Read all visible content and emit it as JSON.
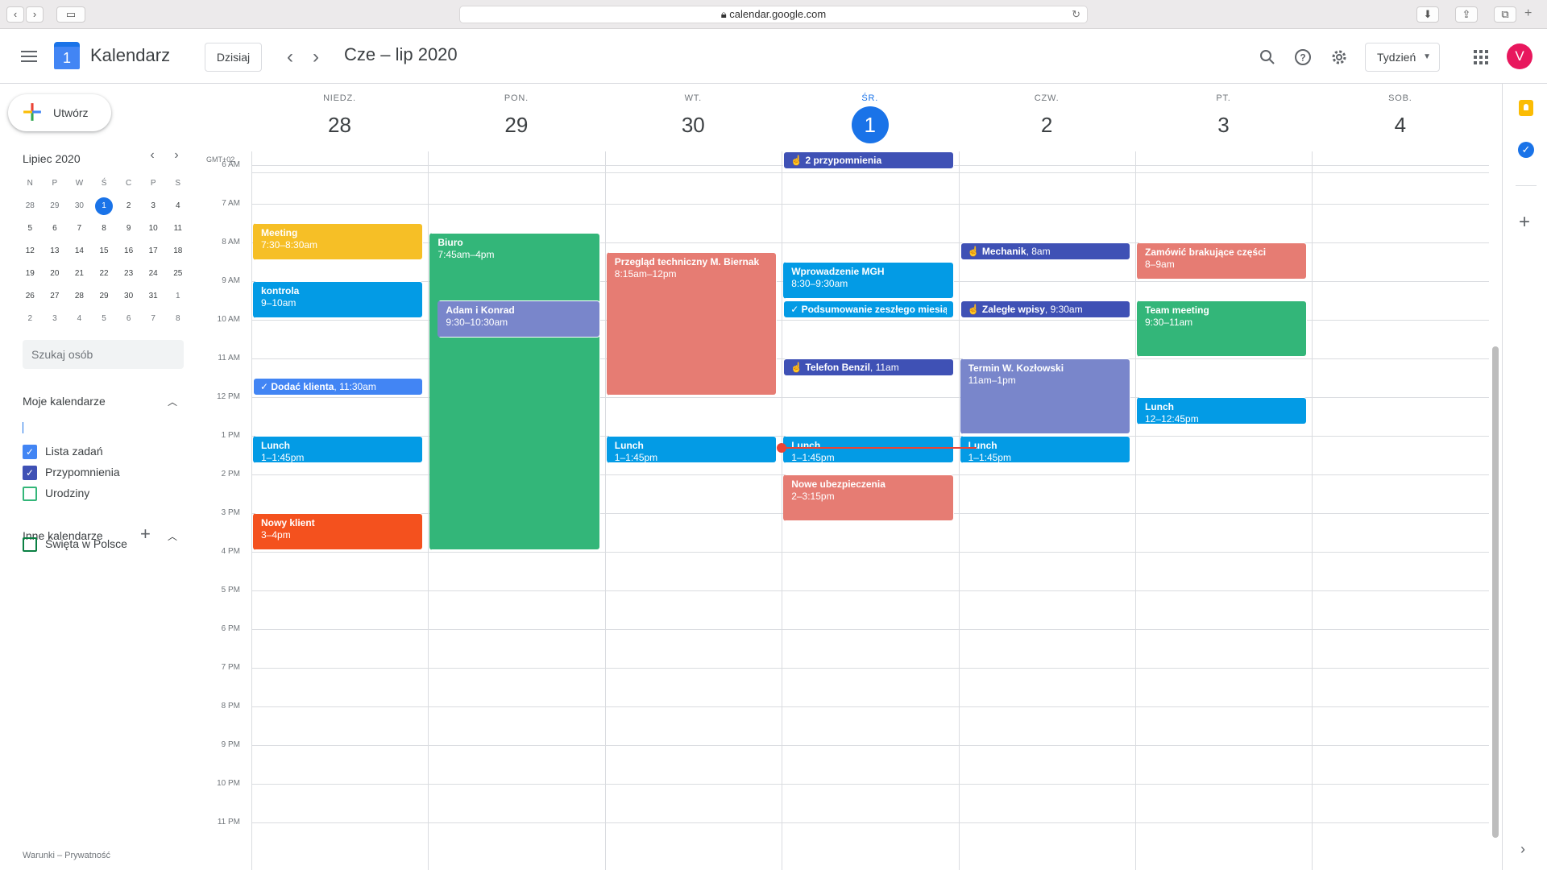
{
  "browser": {
    "url": "calendar.google.com"
  },
  "header": {
    "app_name": "Kalendarz",
    "today_button": "Dzisiaj",
    "period": "Cze – lip 2020",
    "view": "Tydzień",
    "avatar_letter": "V"
  },
  "sidebar": {
    "create_label": "Utwórz",
    "mini_month": "Lipiec 2020",
    "mini_weekdays": [
      "N",
      "P",
      "W",
      "Ś",
      "C",
      "P",
      "S"
    ],
    "mini_weeks": [
      [
        "28",
        "29",
        "30",
        "1",
        "2",
        "3",
        "4"
      ],
      [
        "5",
        "6",
        "7",
        "8",
        "9",
        "10",
        "11"
      ],
      [
        "12",
        "13",
        "14",
        "15",
        "16",
        "17",
        "18"
      ],
      [
        "19",
        "20",
        "21",
        "22",
        "23",
        "24",
        "25"
      ],
      [
        "26",
        "27",
        "28",
        "29",
        "30",
        "31",
        "1"
      ],
      [
        "2",
        "3",
        "4",
        "5",
        "6",
        "7",
        "8"
      ]
    ],
    "search_placeholder": "Szukaj osób",
    "my_calendars_title": "Moje kalendarze",
    "my_calendars": [
      {
        "name": "Lista zadań",
        "checked": true
      },
      {
        "name": "Przypomnienia",
        "checked": true
      },
      {
        "name": "Urodziny",
        "checked": false
      }
    ],
    "other_calendars_title": "Inne kalendarze",
    "other_calendars": [
      {
        "name": "Święta w Polsce",
        "checked": false
      }
    ],
    "footer": "Warunki – Prywatność"
  },
  "week": {
    "timezone": "GMT+02",
    "days": [
      {
        "dow": "NIEDZ.",
        "num": "28"
      },
      {
        "dow": "PON.",
        "num": "29"
      },
      {
        "dow": "WT.",
        "num": "30"
      },
      {
        "dow": "ŚR.",
        "num": "1",
        "today": true
      },
      {
        "dow": "CZW.",
        "num": "2"
      },
      {
        "dow": "PT.",
        "num": "3"
      },
      {
        "dow": "SOB.",
        "num": "4"
      }
    ],
    "hours": [
      "6 AM",
      "7 AM",
      "8 AM",
      "9 AM",
      "10 AM",
      "11 AM",
      "12 PM",
      "1 PM",
      "2 PM",
      "3 PM",
      "4 PM",
      "5 PM",
      "6 PM",
      "7 PM",
      "8 PM",
      "9 PM",
      "10 PM",
      "11 PM"
    ],
    "reminder_banner": "2 przypomnienia",
    "current_time": 13.3
  },
  "events": [
    {
      "day": 0,
      "start": 7.5,
      "end": 8.5,
      "title": "Meeting",
      "time": "7:30–8:30am",
      "color": "#f6bf26"
    },
    {
      "day": 0,
      "start": 9,
      "end": 10,
      "title": "kontrola",
      "time": "9–10am",
      "color": "#039be5"
    },
    {
      "day": 0,
      "start": 11.5,
      "end": 12,
      "title": "Dodać klienta",
      "time": ", 11:30am",
      "color": "#4285f4",
      "chip": true,
      "icon": "task"
    },
    {
      "day": 0,
      "start": 13,
      "end": 13.75,
      "title": "Lunch",
      "time": "1–1:45pm",
      "color": "#039be5"
    },
    {
      "day": 0,
      "start": 15,
      "end": 16,
      "title": "Nowy klient",
      "time": "3–4pm",
      "color": "#f4511e"
    },
    {
      "day": 1,
      "start": 7.75,
      "end": 16,
      "title": "Biuro",
      "time": "7:45am–4pm",
      "color": "#33b679"
    },
    {
      "day": 1,
      "start": 9.5,
      "end": 10.5,
      "title": "Adam i Konrad",
      "time": "9:30–10:30am",
      "color": "#7986cb",
      "inset": true
    },
    {
      "day": 2,
      "start": 8.25,
      "end": 12,
      "title": "Przegląd techniczny M. Biernak",
      "time": "8:15am–12pm",
      "color": "#e67c73"
    },
    {
      "day": 2,
      "start": 13,
      "end": 13.75,
      "title": "Lunch",
      "time": "1–1:45pm",
      "color": "#039be5"
    },
    {
      "day": 3,
      "start": 8.5,
      "end": 9.5,
      "title": "Wprowadzenie MGH",
      "time": "8:30–9:30am",
      "color": "#039be5"
    },
    {
      "day": 3,
      "start": 9.5,
      "end": 10,
      "title": "Podsumowanie zeszłego miesiąca",
      "time": "",
      "color": "#039be5",
      "chip": true,
      "icon": "check"
    },
    {
      "day": 3,
      "start": 11,
      "end": 11.5,
      "title": "Telefon Benzil",
      "time": ", 11am",
      "color": "#3f51b5",
      "chip": true,
      "icon": "reminder"
    },
    {
      "day": 3,
      "start": 13,
      "end": 13.75,
      "title": "Lunch",
      "time": "1–1:45pm",
      "color": "#039be5"
    },
    {
      "day": 3,
      "start": 14,
      "end": 15.25,
      "title": "Nowe ubezpieczenia",
      "time": "2–3:15pm",
      "color": "#e67c73"
    },
    {
      "day": 4,
      "start": 8,
      "end": 8.5,
      "title": "Mechanik",
      "time": ", 8am",
      "color": "#3f51b5",
      "chip": true,
      "icon": "reminder"
    },
    {
      "day": 4,
      "start": 9.5,
      "end": 10,
      "title": "Zaległe wpisy",
      "time": ", 9:30am",
      "color": "#3f51b5",
      "chip": true,
      "icon": "reminder"
    },
    {
      "day": 4,
      "start": 11,
      "end": 13,
      "title": "Termin W. Kozłowski",
      "time": "11am–1pm",
      "color": "#7986cb"
    },
    {
      "day": 4,
      "start": 13,
      "end": 13.75,
      "title": "Lunch",
      "time": "1–1:45pm",
      "color": "#039be5"
    },
    {
      "day": 5,
      "start": 8,
      "end": 9,
      "title": "Zamówić brakujące części",
      "time": "8–9am",
      "color": "#e67c73"
    },
    {
      "day": 5,
      "start": 9.5,
      "end": 11,
      "title": "Team meeting",
      "time": "9:30–11am",
      "color": "#33b679"
    },
    {
      "day": 5,
      "start": 12,
      "end": 12.75,
      "title": "Lunch",
      "time": "12–12:45pm",
      "color": "#039be5"
    }
  ],
  "icons": {
    "menu": "menu-icon",
    "search": "search-icon",
    "help": "help-icon",
    "settings": "gear-icon",
    "apps": "apps-grid-icon",
    "keep": "keep-icon",
    "tasks": "tasks-icon",
    "add": "plus-icon"
  }
}
